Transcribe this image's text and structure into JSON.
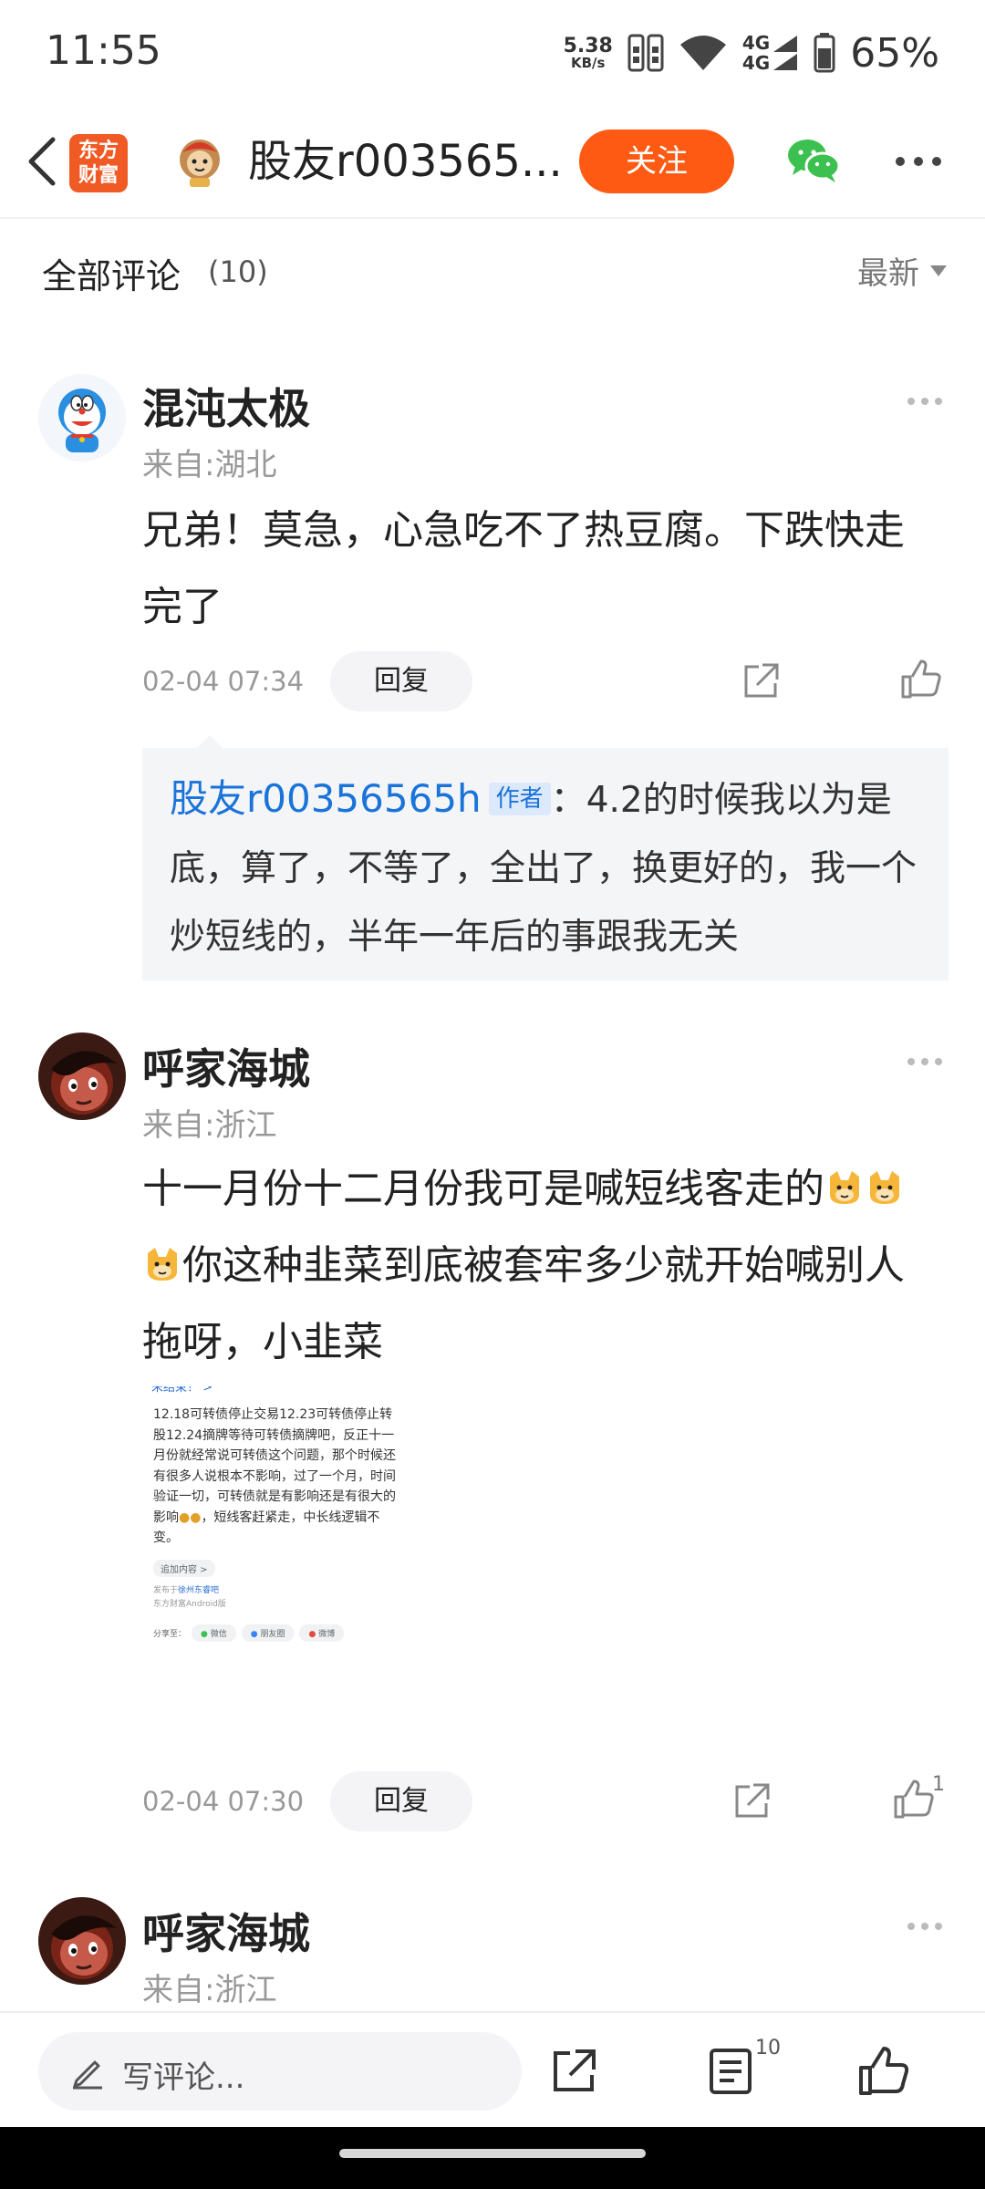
{
  "status_bar": {
    "time": "11:55",
    "net_speed_value": "5.38",
    "net_speed_unit": "KB/s",
    "net_type_1": "4G",
    "net_type_2": "4G",
    "battery": "65%"
  },
  "nav": {
    "app_logo_line1": "东方",
    "app_logo_line2": "财富",
    "title": "股友r003565...",
    "follow_label": "关注"
  },
  "section": {
    "title": "全部评论",
    "count": "(10)",
    "sort_label": "最新"
  },
  "comments": [
    {
      "name": "混沌太极",
      "location": "来自:湖北",
      "body": "兄弟！莫急，心急吃不了热豆腐。下跌快走完了",
      "time": "02-04 07:34",
      "reply_label": "回复",
      "reply": {
        "author": "股友r00356565h",
        "tag": "作者",
        "text": "：4.2的时候我以为是底，算了，不等了，全出了，换更好的，我一个炒短线的，半年一年后的事跟我无关"
      }
    },
    {
      "name": "呼家海城",
      "location": "来自:浙江",
      "body_part1": "十一月份十二月份我可是喊短线客走的",
      "body_part2": "你这种韭菜到底被套牢多少就开始喊别人拖呀，小韭菜",
      "time": "02-04 07:30",
      "reply_label": "回复",
      "like_count": "1",
      "image": {
        "header": "未结束！ >",
        "body": "12.18可转债停止交易12.23可转债停止转股12.24摘牌等待可转债摘牌吧，反正十一月份就经常说可转债这个问题，那个时候还有很多人说根本不影响，过了一个月，时间验证一切，可转债就是有影响还是有很大的影响",
        "body_tail": "，短线客赶紧走，中长线逻辑不变。",
        "chip": "追加内容 >",
        "meta_prefix": "发布于",
        "meta_link": "徐州东睿吧",
        "meta_line2": "东方财富Android版",
        "share_label": "分享至：",
        "share_options": [
          "微信",
          "朋友圈",
          "微博"
        ]
      }
    },
    {
      "name": "呼家海城",
      "location": "来自:浙江"
    }
  ],
  "bottom_bar": {
    "comment_placeholder": "写评论...",
    "comment_count": "10"
  },
  "colors": {
    "accent": "#ff5a14",
    "link": "#1a73d9",
    "logo": "#f05a24"
  }
}
